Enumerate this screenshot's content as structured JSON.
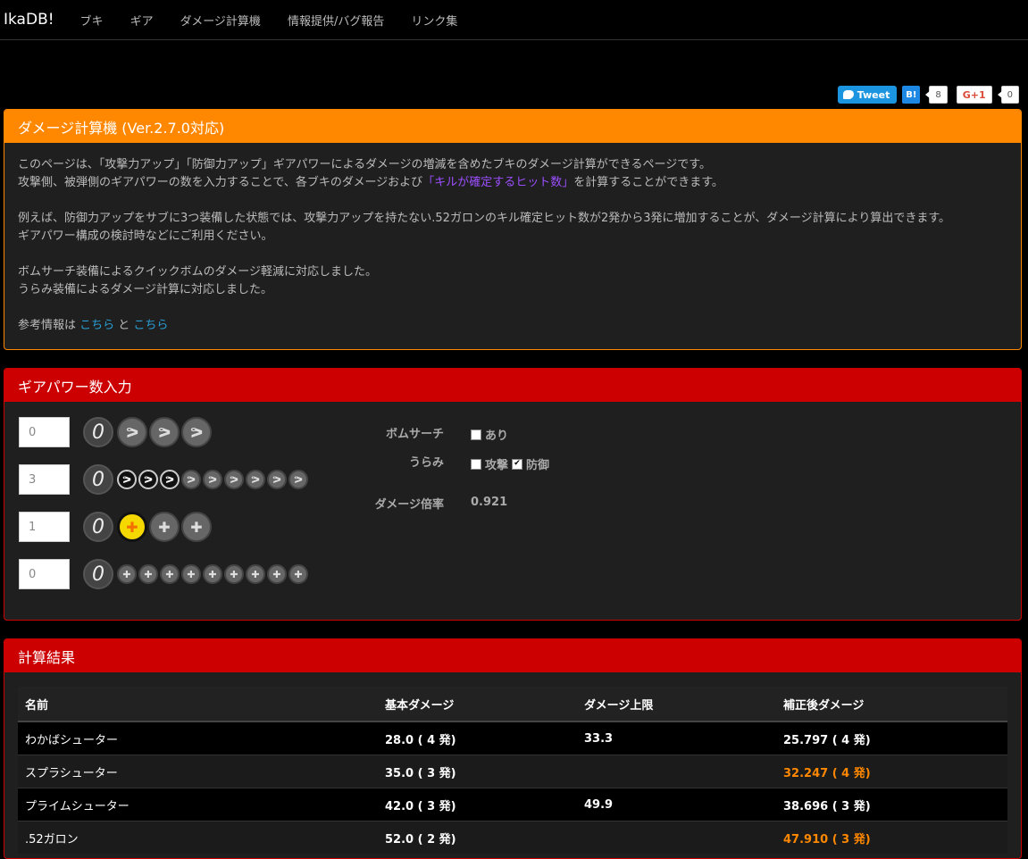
{
  "nav": {
    "brand": "IkaDB!",
    "items": [
      "ブキ",
      "ギア",
      "ダメージ計算機",
      "情報提供/バグ報告",
      "リンク集"
    ]
  },
  "social": {
    "tweet": "Tweet",
    "hatena": "B!",
    "hatena_count": "8",
    "gplus": "G+1",
    "gplus_count": "0"
  },
  "intro": {
    "title": "ダメージ計算機 (Ver.2.7.0対応)",
    "line1": "このページは、「攻撃力アップ」「防御力アップ」ギアパワーによるダメージの増減を含めたブキのダメージ計算ができるページです。",
    "line2_before": "攻撃側、被弾側のギアパワーの数を入力することで、各ブキのダメージおよび",
    "line2_highlight": "「キルが確定するヒット数」",
    "line2_after": "を計算することができます。",
    "line3": "例えば、防御力アップをサブに3つ装備した状態では、攻撃力アップを持たない.52ガロンのキル確定ヒット数が2発から3発に増加することが、ダメージ計算により算出できます。",
    "line4": "ギアパワー構成の検討時などにご利用ください。",
    "line5": "ボムサーチ装備によるクイックボムのダメージ軽減に対応しました。",
    "line6": "うらみ装備によるダメージ計算に対応しました。",
    "ref_prefix": "参考情報は ",
    "ref_link1": "こちら",
    "ref_and": " と ",
    "ref_link2": "こちら"
  },
  "gear": {
    "title": "ギアパワー数入力",
    "rows": [
      {
        "value": "0",
        "zero": "0"
      },
      {
        "value": "3",
        "zero": "0"
      },
      {
        "value": "1",
        "zero": "0"
      },
      {
        "value": "0",
        "zero": "0"
      }
    ],
    "icons": {
      "attack": "flexed-arm-icon",
      "defense": "shield-plus-icon"
    },
    "bomb_search_label": "ボムサーチ",
    "bomb_search_opt": "あり",
    "bomb_search_checked": false,
    "urami_label": "うらみ",
    "urami_attack": "攻撃",
    "urami_attack_checked": false,
    "urami_defense": "防御",
    "urami_defense_checked": true,
    "multiplier_label": "ダメージ倍率",
    "multiplier_value": "0.921"
  },
  "results": {
    "title": "計算結果",
    "headers": [
      "名前",
      "基本ダメージ",
      "ダメージ上限",
      "補正後ダメージ"
    ],
    "rows": [
      {
        "name": "わかばシューター",
        "base": "28.0 ( 4 発)",
        "cap": "33.3",
        "adjusted": "25.797 ( 4 発)",
        "changed": false
      },
      {
        "name": "スプラシューター",
        "base": "35.0 ( 3 発)",
        "cap": "",
        "adjusted": "32.247 ( 4 発)",
        "changed": true
      },
      {
        "name": "プライムシューター",
        "base": "42.0 ( 3 発)",
        "cap": "49.9",
        "adjusted": "38.696 ( 3 発)",
        "changed": false
      },
      {
        "name": ".52ガロン",
        "base": "52.0 ( 2 発)",
        "cap": "",
        "adjusted": "47.910 ( 3 発)",
        "changed": true
      }
    ]
  },
  "colors": {
    "orange": "#ff8800",
    "red": "#cc0000",
    "link": "#2a9fd6",
    "highlight": "#9c4fff"
  }
}
